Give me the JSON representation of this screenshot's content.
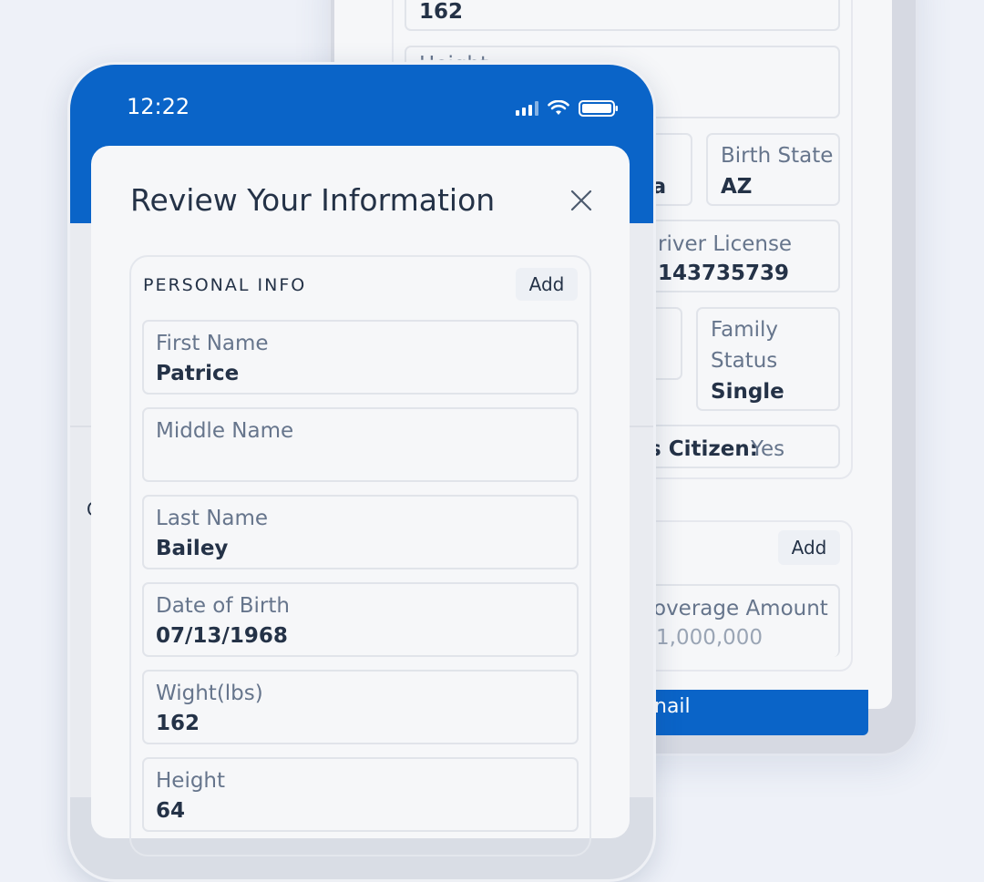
{
  "back": {
    "height_value": "162",
    "height_label_partial": "Height",
    "birth_country_partial": "ca",
    "birth_state_label": "Birth State",
    "birth_state_value": "AZ",
    "driver_license_label": "river License",
    "driver_license_value": "143735739",
    "family_status_label_1": "Family",
    "family_status_label_2": "Status",
    "family_status_value": "Single",
    "citizen_label": "s Citizen:",
    "citizen_value": "Yes",
    "add_label": "Add",
    "coverage_label": "overage Amount",
    "coverage_value": "1,000,000",
    "button_label": "nail",
    "side_letter": "C"
  },
  "status_bar": {
    "time": "12:22"
  },
  "modal": {
    "title": "Review Your Information",
    "section_title": "PERSONAL INFO",
    "add_label": "Add",
    "fields": [
      {
        "label": "First Name",
        "value": "Patrice"
      },
      {
        "label": "Middle Name",
        "value": ""
      },
      {
        "label": "Last Name",
        "value": "Bailey"
      },
      {
        "label": "Date of Birth",
        "value": "07/13/1968"
      },
      {
        "label": "Wight(lbs)",
        "value": "162"
      },
      {
        "label": "Height",
        "value": "64"
      }
    ]
  },
  "colors": {
    "primary": "#0a64c8",
    "text": "#243247",
    "muted": "#66758c"
  }
}
